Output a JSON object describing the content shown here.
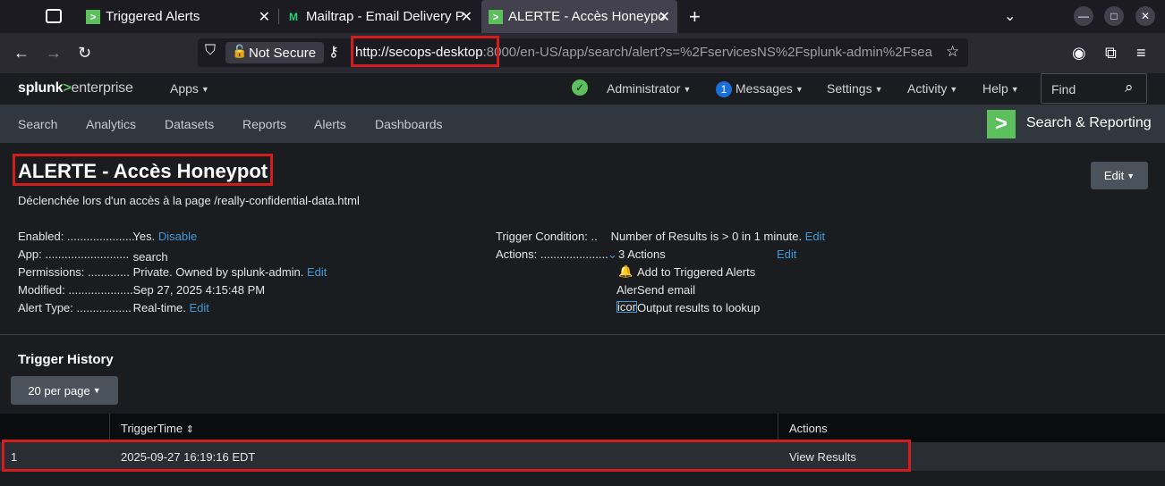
{
  "browser": {
    "tabs": [
      {
        "title": "Triggered Alerts",
        "favicon": "splunk-icon",
        "active": false
      },
      {
        "title": "Mailtrap - Email Delivery P",
        "favicon": "mailtrap-icon",
        "active": false
      },
      {
        "title": "ALERTE - Accès Honeypot",
        "favicon": "splunk-icon",
        "active": true
      }
    ],
    "security_label": "Not Secure",
    "url_host": "http://secops-desktop",
    "url_rest": ":8000/en-US/app/search/alert?s=%2FservicesNS%2Fsplunk-admin%2Fsea"
  },
  "splunk": {
    "brand_main": "splunk",
    "brand_gt": ">",
    "brand_suffix": "enterprise",
    "apps_label": "Apps",
    "user_label": "Administrator",
    "messages_count": "1",
    "messages_label": "Messages",
    "settings_label": "Settings",
    "activity_label": "Activity",
    "help_label": "Help",
    "find_placeholder": "Find"
  },
  "appnav": {
    "items": [
      "Search",
      "Analytics",
      "Datasets",
      "Reports",
      "Alerts",
      "Dashboards"
    ],
    "app_name": "Search & Reporting",
    "app_logo": ">"
  },
  "alert": {
    "title": "ALERTE - Accès Honeypot",
    "edit_label": "Edit",
    "description": "Déclenchée lors d'un accès à la page /really-confidential-data.html",
    "enabled_key": "Enabled: ......................",
    "enabled_value": "Yes.",
    "enabled_link": "Disable",
    "app_key": "App: ..............................",
    "app_value": "search",
    "permissions_key": "Permissions: .............",
    "permissions_value": "Private. Owned by splunk-admin.",
    "permissions_link": "Edit",
    "modified_key": "Modified: ....................",
    "modified_value": "Sep 27, 2025 4:15:48 PM",
    "alert_type_key": "Alert Type: .................",
    "alert_type_value": "Real-time.",
    "alert_type_link": "Edit",
    "trigger_condition_key": "Trigger Condition: ..",
    "trigger_condition_value": "Number of Results is > 0 in 1 minute.",
    "trigger_condition_link": "Edit",
    "actions_key": "Actions: .......................",
    "actions_value": "3 Actions",
    "actions_link": "Edit",
    "action_items": [
      "Add to Triggered Alerts",
      "Send email",
      "Output results to lookup"
    ],
    "alert_icon_text": "Alert",
    "icon_text": "icon"
  },
  "history": {
    "title": "Trigger History",
    "per_page": "20 per page",
    "columns": [
      "",
      "TriggerTime",
      "Actions"
    ],
    "rows": [
      {
        "index": "1",
        "time": "2025-09-27 16:19:16 EDT",
        "action": "View Results"
      }
    ]
  },
  "colors": {
    "accent_green": "#5cc05c",
    "link_blue": "#3c9bd9",
    "highlight_red": "#d11d1d"
  }
}
